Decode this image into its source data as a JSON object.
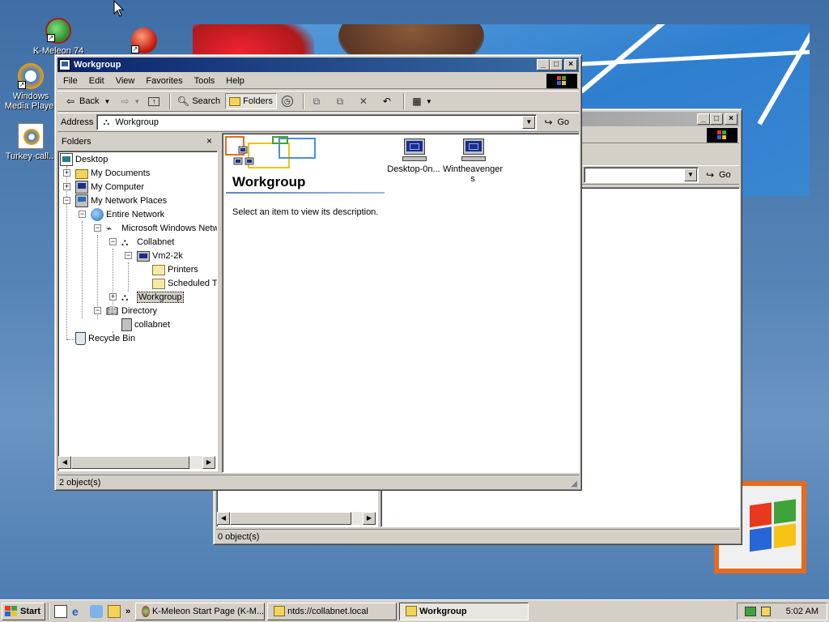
{
  "colors": {
    "title_active": "#0a246a",
    "title_active_end": "#3a6ea5",
    "face": "#d4d0c8",
    "desktop": "#3a6ea5"
  },
  "desktop_icons": [
    {
      "label": "K-Meleon 74",
      "icon": "k-meleon-icon"
    },
    {
      "label": "",
      "icon": "red-ball-icon"
    },
    {
      "label": "Windows Media Player",
      "icon": "media-player-icon"
    },
    {
      "label": "Turkey-call...",
      "icon": "media-file-icon"
    }
  ],
  "back_window": {
    "address_go": "Go",
    "status": "0 object(s)"
  },
  "window": {
    "title": "Workgroup",
    "menu": [
      "File",
      "Edit",
      "View",
      "Favorites",
      "Tools",
      "Help"
    ],
    "toolbar": {
      "back": "Back",
      "search": "Search",
      "folders": "Folders"
    },
    "address": {
      "label": "Address",
      "value": "Workgroup",
      "go": "Go"
    },
    "folders_pane": {
      "title": "Folders",
      "close": "×",
      "tree": [
        {
          "label": "Desktop",
          "icon": "desktop-icon"
        },
        {
          "label": "My Documents",
          "icon": "my-documents-icon"
        },
        {
          "label": "My Computer",
          "icon": "my-computer-icon"
        },
        {
          "label": "My Network Places",
          "icon": "network-places-icon"
        },
        {
          "label": "Entire Network",
          "icon": "entire-network-icon"
        },
        {
          "label": "Microsoft Windows Netw",
          "icon": "windows-network-icon"
        },
        {
          "label": "Collabnet",
          "icon": "domain-icon"
        },
        {
          "label": "Vm2-2k",
          "icon": "computer-icon"
        },
        {
          "label": "Printers",
          "icon": "printers-folder-icon"
        },
        {
          "label": "Scheduled Ta",
          "icon": "scheduled-tasks-icon"
        },
        {
          "label": "Workgroup",
          "icon": "workgroup-icon",
          "selected": true
        },
        {
          "label": "Directory",
          "icon": "directory-icon"
        },
        {
          "label": "collabnet",
          "icon": "directory-server-icon"
        },
        {
          "label": "Recycle Bin",
          "icon": "recycle-bin-icon"
        }
      ]
    },
    "content": {
      "heading": "Workgroup",
      "description": "Select an item to view its description.",
      "items": [
        {
          "label": "Desktop-0n...",
          "icon": "computer-icon"
        },
        {
          "label": "Wintheavengers",
          "icon": "computer-icon"
        }
      ]
    },
    "status": "2 object(s)"
  },
  "taskbar": {
    "start": "Start",
    "quick_launch_more": "»",
    "tasks": [
      {
        "label": "K-Meleon Start Page (K-M...",
        "icon": "k-meleon-icon",
        "active": false
      },
      {
        "label": "ntds://collabnet.local",
        "icon": "search-folder-icon",
        "active": false
      },
      {
        "label": "Workgroup",
        "icon": "workgroup-icon",
        "active": true
      }
    ],
    "clock": "5:02 AM"
  }
}
